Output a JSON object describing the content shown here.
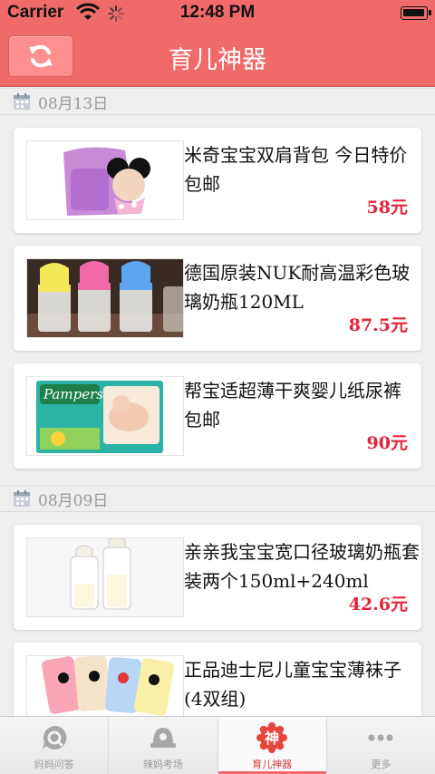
{
  "status_bar": {
    "carrier": "Carrier",
    "time": "12:48 PM"
  },
  "nav": {
    "title": "育儿神器",
    "refresh_icon": "refresh-icon"
  },
  "sections": [
    {
      "date": "08月13日",
      "items": [
        {
          "title": "米奇宝宝双肩背包 今日特价包邮",
          "price": "58元"
        },
        {
          "title": "德国原装NUK耐高温彩色玻璃奶瓶120ML",
          "price": "87.5元"
        },
        {
          "title": "帮宝适超薄干爽婴儿纸尿裤 包邮",
          "price": "90元"
        }
      ]
    },
    {
      "date": "08月09日",
      "items": [
        {
          "title": "亲亲我宝宝宽口径玻璃奶瓶套装两个150ml+240ml",
          "price": "42.6元"
        },
        {
          "title": "正品迪士尼儿童宝宝薄袜子(4双组)",
          "price": ""
        }
      ]
    }
  ],
  "tabs": [
    {
      "label": "妈妈问答",
      "icon": "qa-bubble-icon"
    },
    {
      "label": "辣妈考场",
      "icon": "exam-hat-icon"
    },
    {
      "label": "育儿神器",
      "icon": "shen-badge-icon",
      "badge": "神",
      "active": true
    },
    {
      "label": "更多",
      "icon": "more-dots-icon"
    }
  ],
  "colors": {
    "accent": "#f06a6a",
    "price": "#e5243b",
    "date_text": "#999999"
  }
}
